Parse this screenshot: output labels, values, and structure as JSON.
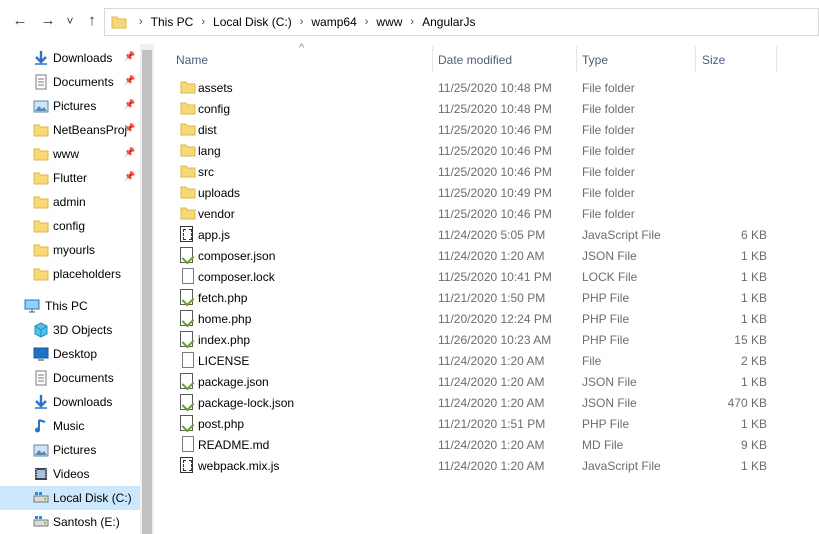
{
  "toolbar": {
    "back": "←",
    "forward": "→",
    "recent": "˅",
    "up": "↑"
  },
  "breadcrumb": [
    "This PC",
    "Local Disk (C:)",
    "wamp64",
    "www",
    "AngularJs"
  ],
  "breadcrumb_sep": "›",
  "sidebar": {
    "quick_access": [
      {
        "label": "Downloads",
        "icon": "download-icon",
        "pinned": true
      },
      {
        "label": "Documents",
        "icon": "documents-icon",
        "pinned": true
      },
      {
        "label": "Pictures",
        "icon": "pictures-icon",
        "pinned": true
      },
      {
        "label": "NetBeansProj",
        "icon": "folder-icon",
        "pinned": true
      },
      {
        "label": "www",
        "icon": "folder-icon",
        "pinned": true
      },
      {
        "label": "Flutter",
        "icon": "folder-icon",
        "pinned": true
      },
      {
        "label": "admin",
        "icon": "folder-icon",
        "pinned": false
      },
      {
        "label": "config",
        "icon": "folder-icon",
        "pinned": false
      },
      {
        "label": "myourls",
        "icon": "folder-icon",
        "pinned": false
      },
      {
        "label": "placeholders",
        "icon": "folder-icon",
        "pinned": false
      }
    ],
    "this_pc": "This PC",
    "pc_items": [
      {
        "label": "3D Objects",
        "icon": "3d-objects-icon"
      },
      {
        "label": "Desktop",
        "icon": "desktop-icon"
      },
      {
        "label": "Documents",
        "icon": "documents-icon"
      },
      {
        "label": "Downloads",
        "icon": "download-icon"
      },
      {
        "label": "Music",
        "icon": "music-icon"
      },
      {
        "label": "Pictures",
        "icon": "pictures-icon"
      },
      {
        "label": "Videos",
        "icon": "videos-icon"
      },
      {
        "label": "Local Disk (C:)",
        "icon": "drive-icon",
        "selected": true
      },
      {
        "label": "Santosh (E:)",
        "icon": "drive-icon"
      }
    ],
    "pin_glyph": "📌"
  },
  "columns": {
    "name": "Name",
    "date": "Date modified",
    "type": "Type",
    "size": "Size",
    "sort_indicator": "^"
  },
  "files": [
    {
      "name": "assets",
      "date": "11/25/2020 10:48 PM",
      "type": "File folder",
      "size": "",
      "icon": "folder"
    },
    {
      "name": "config",
      "date": "11/25/2020 10:48 PM",
      "type": "File folder",
      "size": "",
      "icon": "folder"
    },
    {
      "name": "dist",
      "date": "11/25/2020 10:46 PM",
      "type": "File folder",
      "size": "",
      "icon": "folder"
    },
    {
      "name": "lang",
      "date": "11/25/2020 10:46 PM",
      "type": "File folder",
      "size": "",
      "icon": "folder"
    },
    {
      "name": "src",
      "date": "11/25/2020 10:46 PM",
      "type": "File folder",
      "size": "",
      "icon": "folder"
    },
    {
      "name": "uploads",
      "date": "11/25/2020 10:49 PM",
      "type": "File folder",
      "size": "",
      "icon": "folder"
    },
    {
      "name": "vendor",
      "date": "11/25/2020 10:46 PM",
      "type": "File folder",
      "size": "",
      "icon": "folder"
    },
    {
      "name": "app.js",
      "date": "11/24/2020 5:05 PM",
      "type": "JavaScript File",
      "size": "6 KB",
      "icon": "js"
    },
    {
      "name": "composer.json",
      "date": "11/24/2020 1:20 AM",
      "type": "JSON File",
      "size": "1 KB",
      "icon": "php"
    },
    {
      "name": "composer.lock",
      "date": "11/25/2020 10:41 PM",
      "type": "LOCK File",
      "size": "1 KB",
      "icon": "doc"
    },
    {
      "name": "fetch.php",
      "date": "11/21/2020 1:50 PM",
      "type": "PHP File",
      "size": "1 KB",
      "icon": "php"
    },
    {
      "name": "home.php",
      "date": "11/20/2020 12:24 PM",
      "type": "PHP File",
      "size": "1 KB",
      "icon": "php"
    },
    {
      "name": "index.php",
      "date": "11/26/2020 10:23 AM",
      "type": "PHP File",
      "size": "15 KB",
      "icon": "php"
    },
    {
      "name": "LICENSE",
      "date": "11/24/2020 1:20 AM",
      "type": "File",
      "size": "2 KB",
      "icon": "doc"
    },
    {
      "name": "package.json",
      "date": "11/24/2020 1:20 AM",
      "type": "JSON File",
      "size": "1 KB",
      "icon": "php"
    },
    {
      "name": "package-lock.json",
      "date": "11/24/2020 1:20 AM",
      "type": "JSON File",
      "size": "470 KB",
      "icon": "php"
    },
    {
      "name": "post.php",
      "date": "11/21/2020 1:51 PM",
      "type": "PHP File",
      "size": "1 KB",
      "icon": "php"
    },
    {
      "name": "README.md",
      "date": "11/24/2020 1:20 AM",
      "type": "MD File",
      "size": "9 KB",
      "icon": "doc"
    },
    {
      "name": "webpack.mix.js",
      "date": "11/24/2020 1:20 AM",
      "type": "JavaScript File",
      "size": "1 KB",
      "icon": "js"
    }
  ],
  "colors": {
    "folder": "#f8d775",
    "selected": "#cce8ff",
    "header_text": "#4c607a",
    "secondary_text": "#6d6d6d"
  }
}
